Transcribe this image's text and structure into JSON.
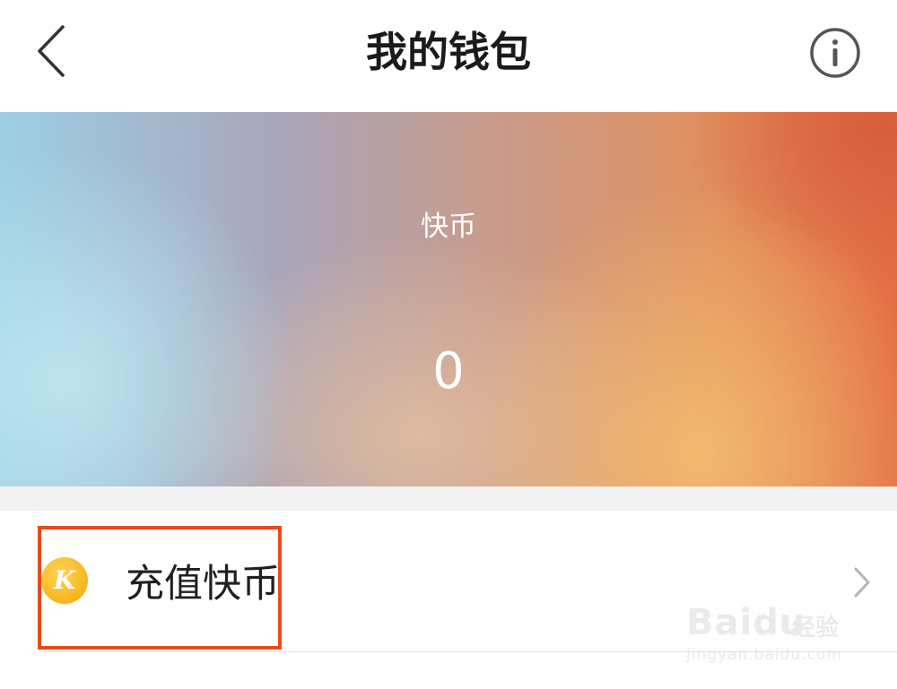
{
  "header": {
    "title": "我的钱包",
    "back_icon": "chevron-left-icon",
    "info_icon": "info-circle-icon"
  },
  "balance": {
    "label": "快币",
    "value": "0"
  },
  "recharge": {
    "label": "充值快币",
    "coin_letter": "K",
    "chevron_icon": "chevron-right-icon"
  },
  "highlight_color": "#ea4a1a",
  "watermark": {
    "brand": "Baidu",
    "sub": "经验",
    "url": "jingyan.baidu.com"
  }
}
